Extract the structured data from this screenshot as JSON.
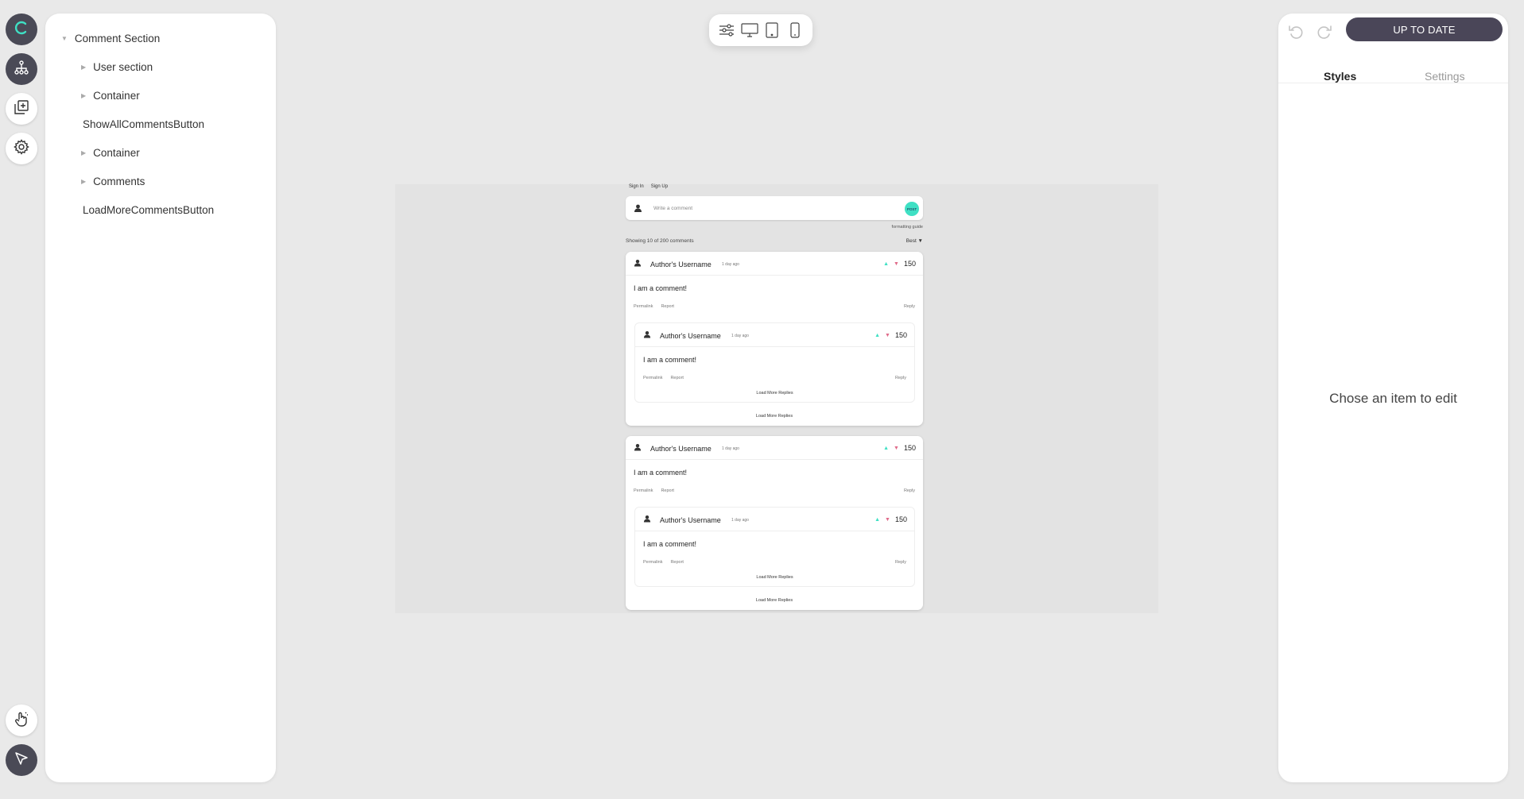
{
  "layers": {
    "items": [
      {
        "label": "Comment Section",
        "expandable": true
      },
      {
        "label": "User section",
        "expandable": true
      },
      {
        "label": "Container",
        "expandable": true
      },
      {
        "label": "ShowAllCommentsButton",
        "expandable": false
      },
      {
        "label": "Container",
        "expandable": true
      },
      {
        "label": "Comments",
        "expandable": true
      },
      {
        "label": "LoadMoreCommentsButton",
        "expandable": false
      }
    ]
  },
  "preview": {
    "sign_in": "Sign In",
    "sign_up": "Sign Up",
    "comment_placeholder": "Write a comment",
    "post_label": "POST",
    "formatting_guide": "formatting guide",
    "showing": "Showing 10 of 200 comments",
    "sort": "Best ▼",
    "comment": {
      "author": "Author's Username",
      "ago": "1 day ago",
      "score": "150",
      "text": "I am a comment!",
      "permalink": "Permalink",
      "report": "Report",
      "reply": "Reply",
      "load_more_replies": "Load More Replies"
    }
  },
  "right_panel": {
    "status_button": "UP TO DATE",
    "tabs": [
      "Styles",
      "Settings"
    ],
    "empty_message": "Chose an item to edit"
  },
  "colors": {
    "accent": "#3fe0c4",
    "downvote": "#e06b8a",
    "dark": "#4a4658"
  }
}
